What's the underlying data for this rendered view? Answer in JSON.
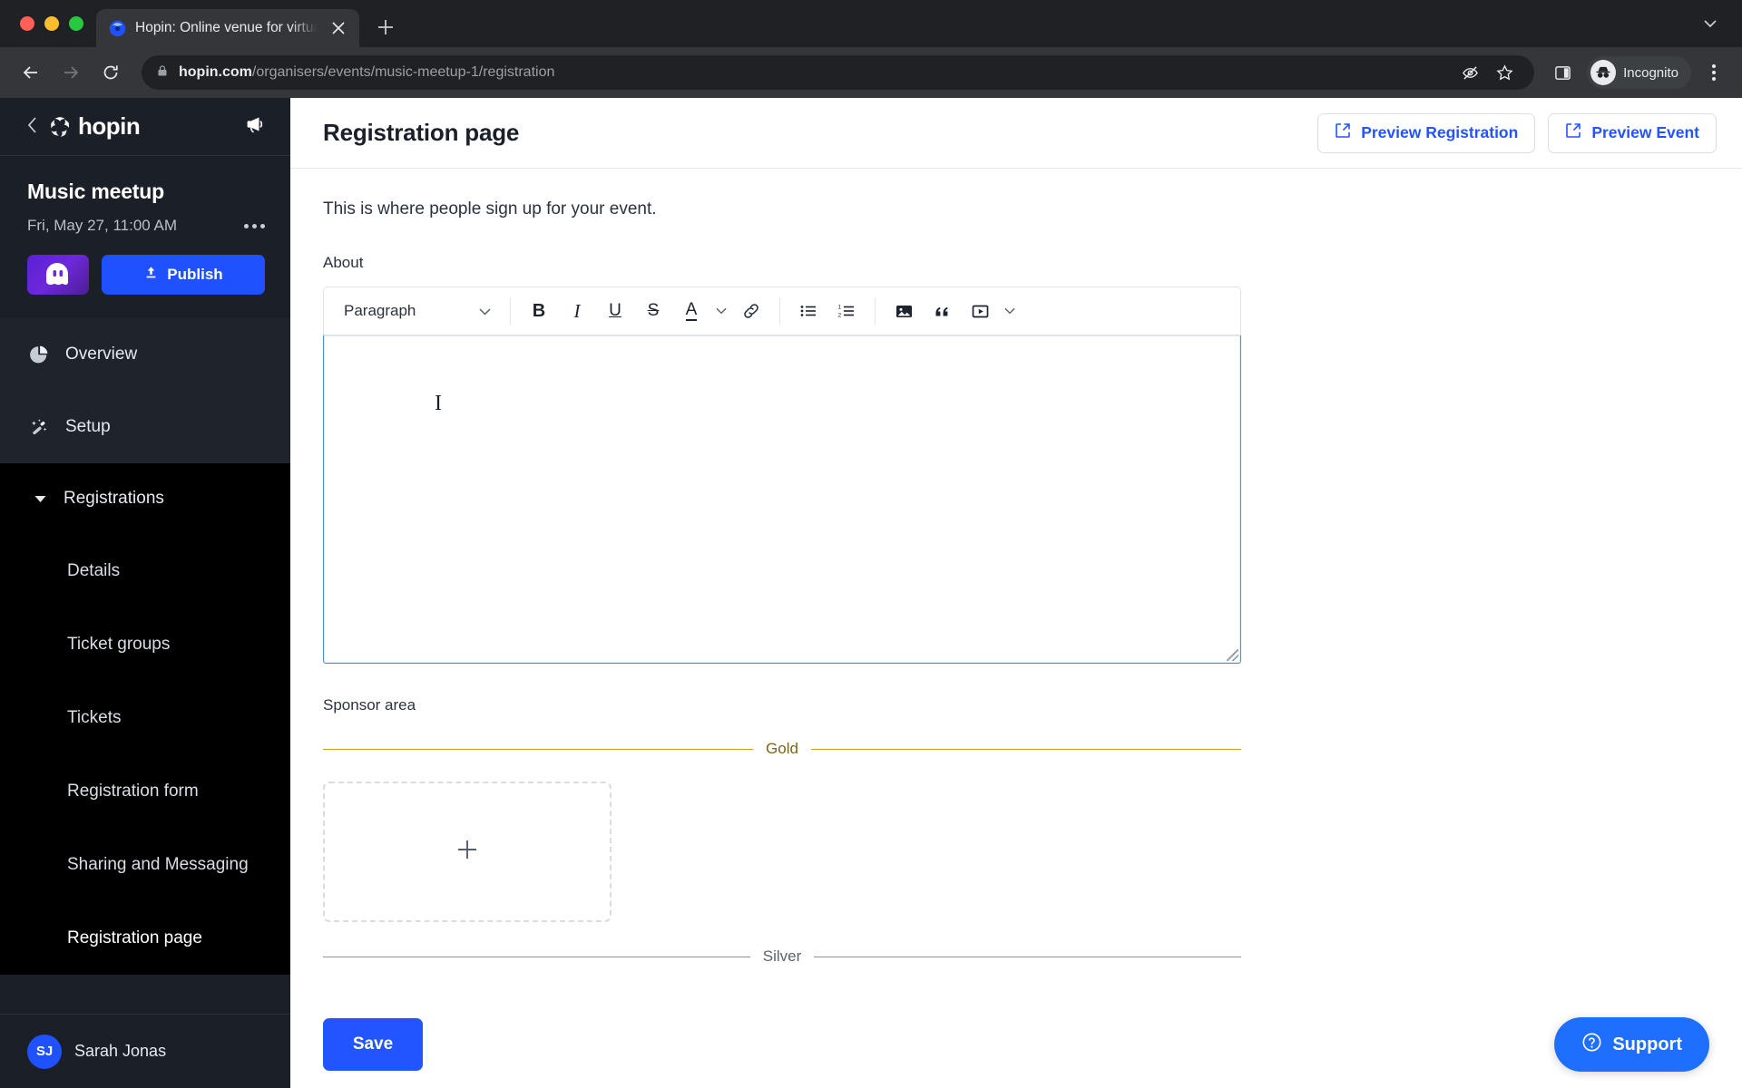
{
  "browser": {
    "tab": {
      "title": "Hopin: Online venue for virtual",
      "favicon_icon": "hopin-favicon",
      "close_icon": "close-icon"
    },
    "new_tab_icon": "plus-icon",
    "tab_search_icon": "chevron-down-icon",
    "back_icon": "arrow-left-icon",
    "forward_icon": "arrow-right-icon",
    "reload_icon": "reload-icon",
    "lock_icon": "lock-icon",
    "url_domain": "hopin.com",
    "url_path": "/organisers/events/music-meetup-1/registration",
    "third_party_cookie_icon": "eye-off-icon",
    "bookmark_icon": "star-icon",
    "side_panel_icon": "side-panel-icon",
    "profile": {
      "label": "Incognito",
      "icon": "incognito-icon"
    },
    "menu_icon": "three-dots-vertical-icon"
  },
  "sidebar": {
    "back_icon": "chevron-left-icon",
    "brand": "hopin",
    "brand_logo_icon": "hopin-logo-icon",
    "announce_icon": "megaphone-icon",
    "event": {
      "name": "Music meetup",
      "date": "Fri, May 27, 11:00 AM",
      "more_icon": "ellipsis-icon",
      "logo_icon": "ghost-avatar-icon",
      "publish_label": "Publish",
      "publish_icon": "upload-icon"
    },
    "items": [
      {
        "label": "Overview",
        "icon": "pie-chart-icon"
      },
      {
        "label": "Setup",
        "icon": "magic-wand-icon"
      }
    ],
    "group": {
      "label": "Registrations",
      "caret_icon": "caret-down-icon",
      "children": [
        {
          "label": "Details"
        },
        {
          "label": "Ticket groups"
        },
        {
          "label": "Tickets"
        },
        {
          "label": "Registration form"
        },
        {
          "label": "Sharing and Messaging"
        },
        {
          "label": "Registration page"
        }
      ]
    },
    "user": {
      "initials": "SJ",
      "name": "Sarah Jonas"
    }
  },
  "header": {
    "title": "Registration page",
    "preview_registration": "Preview Registration",
    "preview_event": "Preview Event",
    "external_link_icon": "external-link-icon"
  },
  "content": {
    "lead": "This is where people sign up for your event.",
    "about_label": "About",
    "editor": {
      "block_format": "Paragraph",
      "chevron_icon": "chevron-down-icon",
      "buttons": [
        {
          "name": "bold-button",
          "glyph": "B"
        },
        {
          "name": "italic-button",
          "glyph": "I"
        },
        {
          "name": "underline-button",
          "glyph": "U"
        },
        {
          "name": "strikethrough-button",
          "glyph": "S"
        },
        {
          "name": "text-color-button",
          "glyph": "A"
        }
      ],
      "value": "",
      "placeholder": ""
    },
    "sponsor_label": "Sponsor area",
    "tiers": [
      {
        "label": "Gold",
        "color": "#c8a021"
      },
      {
        "label": "Silver",
        "color": "#8d939b"
      }
    ],
    "add_sponsor_icon": "plus-icon"
  },
  "footer": {
    "save_label": "Save",
    "support_label": "Support",
    "support_icon": "question-circle-icon"
  },
  "colors": {
    "accent_blue": "#2255ff",
    "publish_blue": "#1f51ff",
    "sidebar_bg": "#1b1f27",
    "sidebar_group_bg": "#000000",
    "gold": "#c8a021",
    "silver": "#8d939b",
    "editor_focus_border": "#4f8fd4"
  }
}
